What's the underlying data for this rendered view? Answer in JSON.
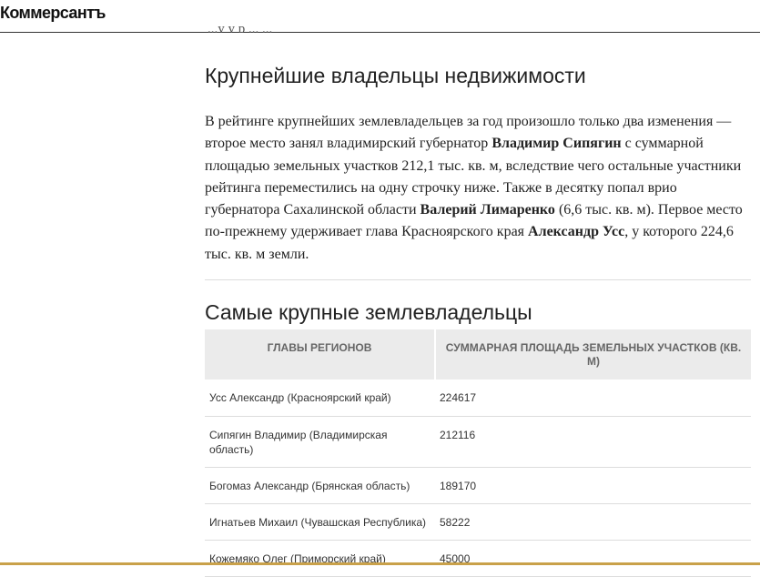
{
  "header": {
    "logo": "Коммерсантъ",
    "cut_text": "...у у р ... ..."
  },
  "section1": {
    "title": "Крупнейшие владельцы недвижимости",
    "p1": "В рейтинге крупнейших землевладельцев за год произошло только два изменения — второе место занял владимирский губернатор ",
    "name1": "Владимир Сипягин",
    "p2": " с суммарной площадью земельных участков 212,1 тыс. кв. м, вследствие чего остальные участники рейтинга переместились на одну строчку ниже. Также в десятку попал врио губернатора Сахалинской области ",
    "name2": "Валерий Лимаренко",
    "p3": " (6,6 тыс. кв. м). Первое место по-прежнему удерживает глава Красноярского края ",
    "name3": "Александр Усс",
    "p4": ", у которого 224,6 тыс. кв. м земли."
  },
  "section2": {
    "title": "Самые крупные землевладельцы",
    "headers": [
      "Главы регионов",
      "Суммарная площадь земельных участков (кв. м)"
    ],
    "rows": [
      {
        "name": "Усс Александр (Красноярский край)",
        "value": "224617"
      },
      {
        "name": "Сипягин Владимир (Владимирская область)",
        "value": "212116"
      },
      {
        "name": "Богомаз Александр (Брянская область)",
        "value": "189170"
      },
      {
        "name": "Игнатьев Михаил (Чувашская Республика)",
        "value": "58222"
      },
      {
        "name": "Кожемяко Олег (Приморский край)",
        "value": "45000"
      }
    ]
  }
}
